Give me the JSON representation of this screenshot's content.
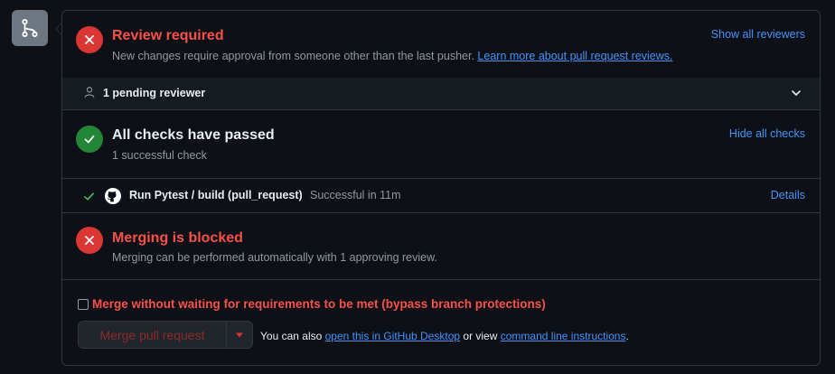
{
  "icons": {
    "branch": "git-pull-request-icon",
    "error": "x-icon",
    "success": "check-icon",
    "person": "person-icon",
    "chevron": "chevron-down-icon",
    "github": "github-mark-icon",
    "caret": "triangle-down-icon"
  },
  "colors": {
    "danger": "#f85149",
    "danger_bg": "#da3633",
    "success_bg": "#238636",
    "success_fg": "#3fb950",
    "link": "#4493f8"
  },
  "review": {
    "title": "Review required",
    "description": "New changes require approval from someone other than the last pusher.",
    "learn_more": "Learn more about pull request reviews.",
    "show_all": "Show all reviewers",
    "pending": "1 pending reviewer"
  },
  "checks": {
    "title": "All checks have passed",
    "subtitle": "1 successful check",
    "hide_all": "Hide all checks",
    "items": [
      {
        "name": "Run Pytest / build (pull_request)",
        "status": "Successful in 11m",
        "details": "Details"
      }
    ]
  },
  "merge": {
    "title": "Merging is blocked",
    "subtitle": "Merging can be performed automatically with 1 approving review.",
    "bypass_label": "Merge without waiting for requirements to be met (bypass branch protections)",
    "button": "Merge pull request",
    "also_prefix": "You can also",
    "desktop_link": "open this in GitHub Desktop",
    "or_view": "or view",
    "cli_link": "command line instructions",
    "period": "."
  }
}
